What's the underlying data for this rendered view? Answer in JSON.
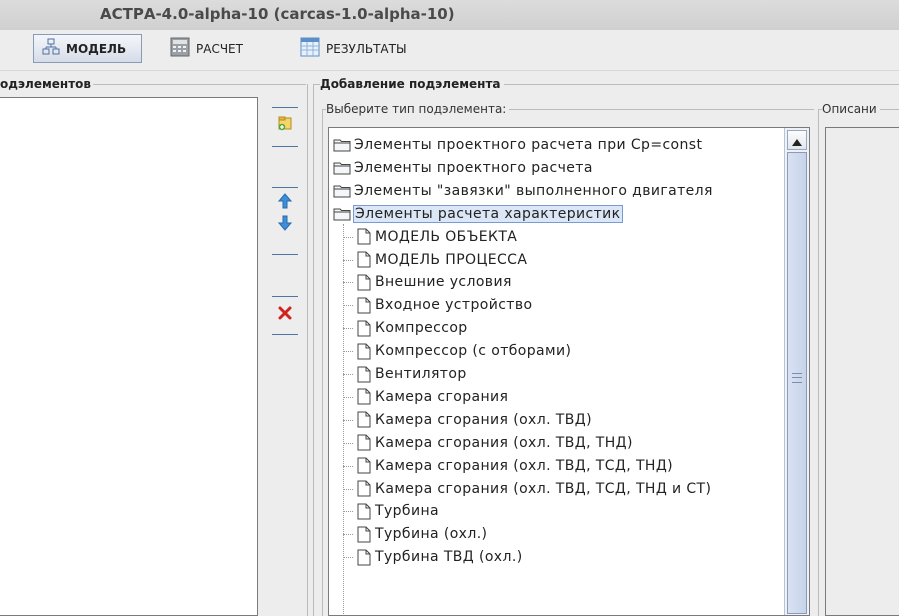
{
  "window": {
    "title": "АСТРА-4.0-alpha-10 (carcas-1.0-alpha-10)"
  },
  "toolbar": {
    "model_label": "МОДЕЛЬ",
    "calc_label": "РАСЧЕТ",
    "results_label": "РЕЗУЛЬТАТЫ"
  },
  "left_panel": {
    "title": "одэлементов"
  },
  "add_group": {
    "title": "Добавление подэлемента",
    "type_label": "Выберите тип подэлемента:",
    "description_label": "Описани"
  },
  "tree": {
    "groups": [
      "Элементы проектного расчета при Ср=const",
      "Элементы проектного расчета",
      "Элементы \"завязки\" выполненного двигателя",
      "Элементы расчета характеристик"
    ],
    "selected_group": "Элементы расчета характеристик",
    "children": [
      "МОДЕЛЬ ОБЪЕКТА",
      "МОДЕЛЬ ПРОЦЕССА",
      "Внешние условия",
      "Входное устройство",
      "Компрессор",
      "Компрессор (с отборами)",
      "Вентилятор",
      "Камера сгорания",
      "Камера сгорания (охл. ТВД)",
      "Камера сгорания (охл. ТВД, ТНД)",
      "Камера сгорания (охл. ТВД, ТСД, ТНД)",
      "Камера сгорания (охл. ТВД, ТСД, ТНД и СТ)",
      "Турбина",
      "Турбина (охл.)",
      "Турбина ТВД (охл.)"
    ]
  },
  "icons": {
    "model": "hierarchy-icon",
    "calc": "calculator-icon",
    "results": "table-icon",
    "add": "add-element-icon",
    "up": "arrow-up-icon",
    "down": "arrow-down-icon",
    "delete": "delete-icon",
    "folder": "folder-icon",
    "document": "document-icon"
  },
  "colors": {
    "selection_bg": "#dbe6f6",
    "selection_border": "#7a9ad4",
    "delete": "#d2221e",
    "arrow": "#3d8fdc"
  }
}
